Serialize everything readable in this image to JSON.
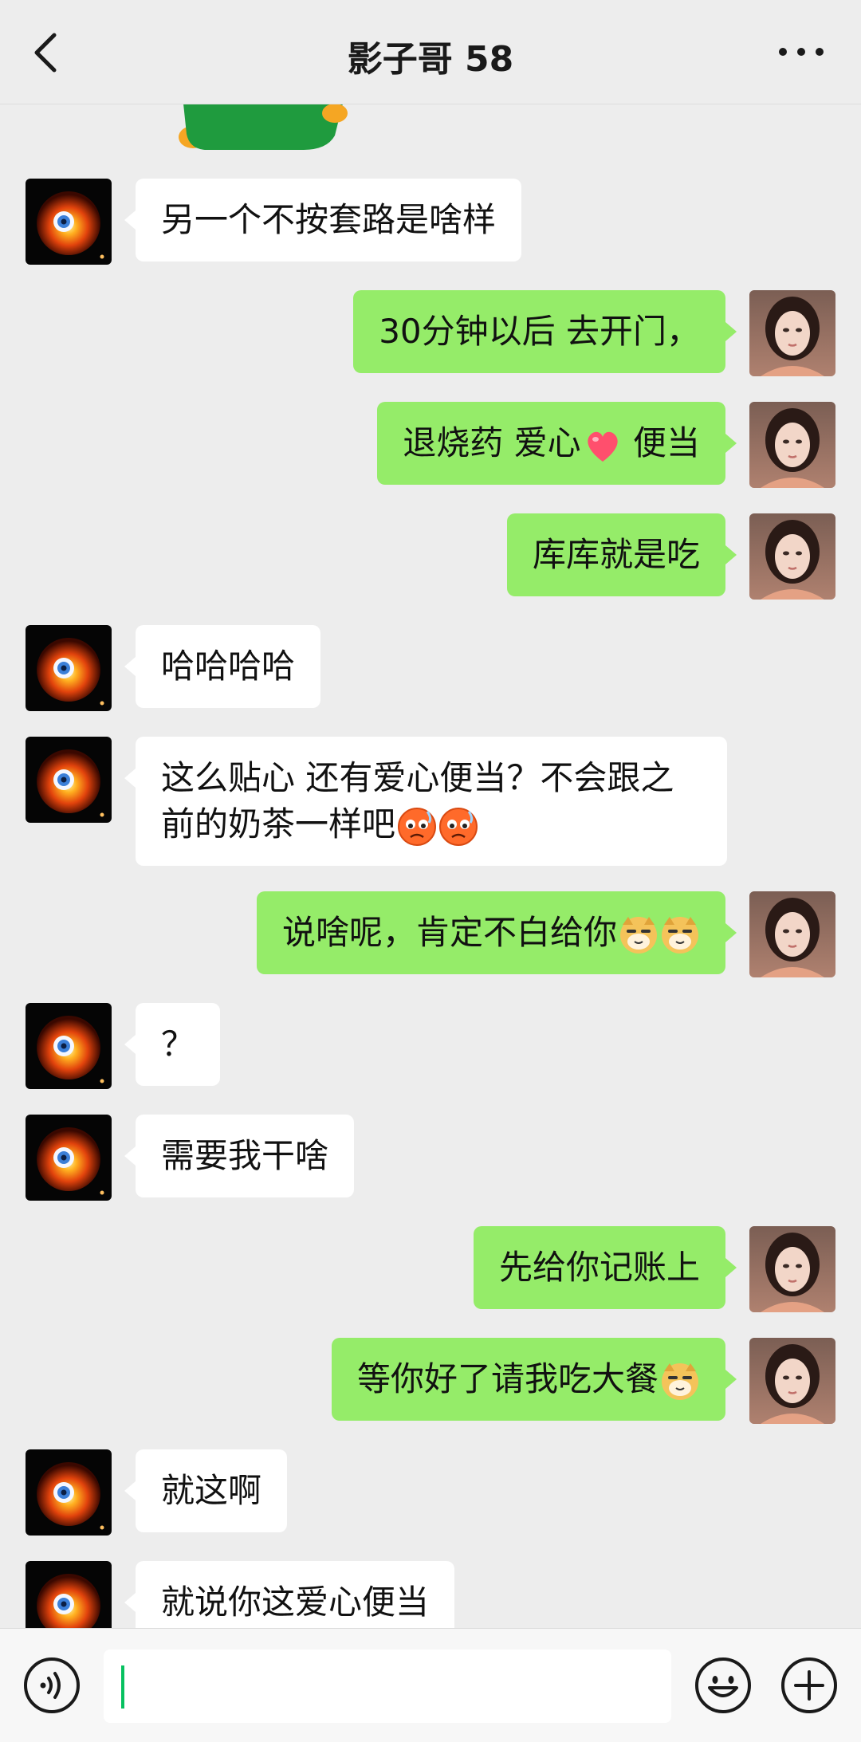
{
  "header": {
    "title": "影子哥 58",
    "back_icon": "chevron-left-icon",
    "more_icon": "more-dots-icon"
  },
  "colors": {
    "background": "#ededed",
    "bubble_sent": "#95ec69",
    "bubble_received": "#ffffff",
    "accent": "#07c160"
  },
  "messages": [
    {
      "side": "left",
      "text": "另一个不按套路是啥样"
    },
    {
      "side": "right",
      "text": "30分钟以后 去开门，"
    },
    {
      "side": "right",
      "text": "退烧药 爱心",
      "text_after": " 便当",
      "emoji": "heart"
    },
    {
      "side": "right",
      "text": "库库就是吃"
    },
    {
      "side": "left",
      "text": "哈哈哈哈"
    },
    {
      "side": "left",
      "text": "这么贴心 还有爱心便当？不会跟之前的奶茶一样吧",
      "emoji": "frown-face x2"
    },
    {
      "side": "right",
      "text": "说啥呢，肯定不白给你",
      "emoji": "doge x2"
    },
    {
      "side": "left",
      "text": "？"
    },
    {
      "side": "left",
      "text": "需要我干啥"
    },
    {
      "side": "right",
      "text": "先给你记账上"
    },
    {
      "side": "right",
      "text": "等你好了请我吃大餐",
      "emoji": "doge"
    },
    {
      "side": "left",
      "text": "就这啊"
    },
    {
      "side": "left",
      "text": "就说你这爱心便当"
    }
  ],
  "footer": {
    "voice_icon": "voice-icon",
    "input_value": "",
    "emoji_icon": "emoji-icon",
    "plus_icon": "plus-icon"
  }
}
